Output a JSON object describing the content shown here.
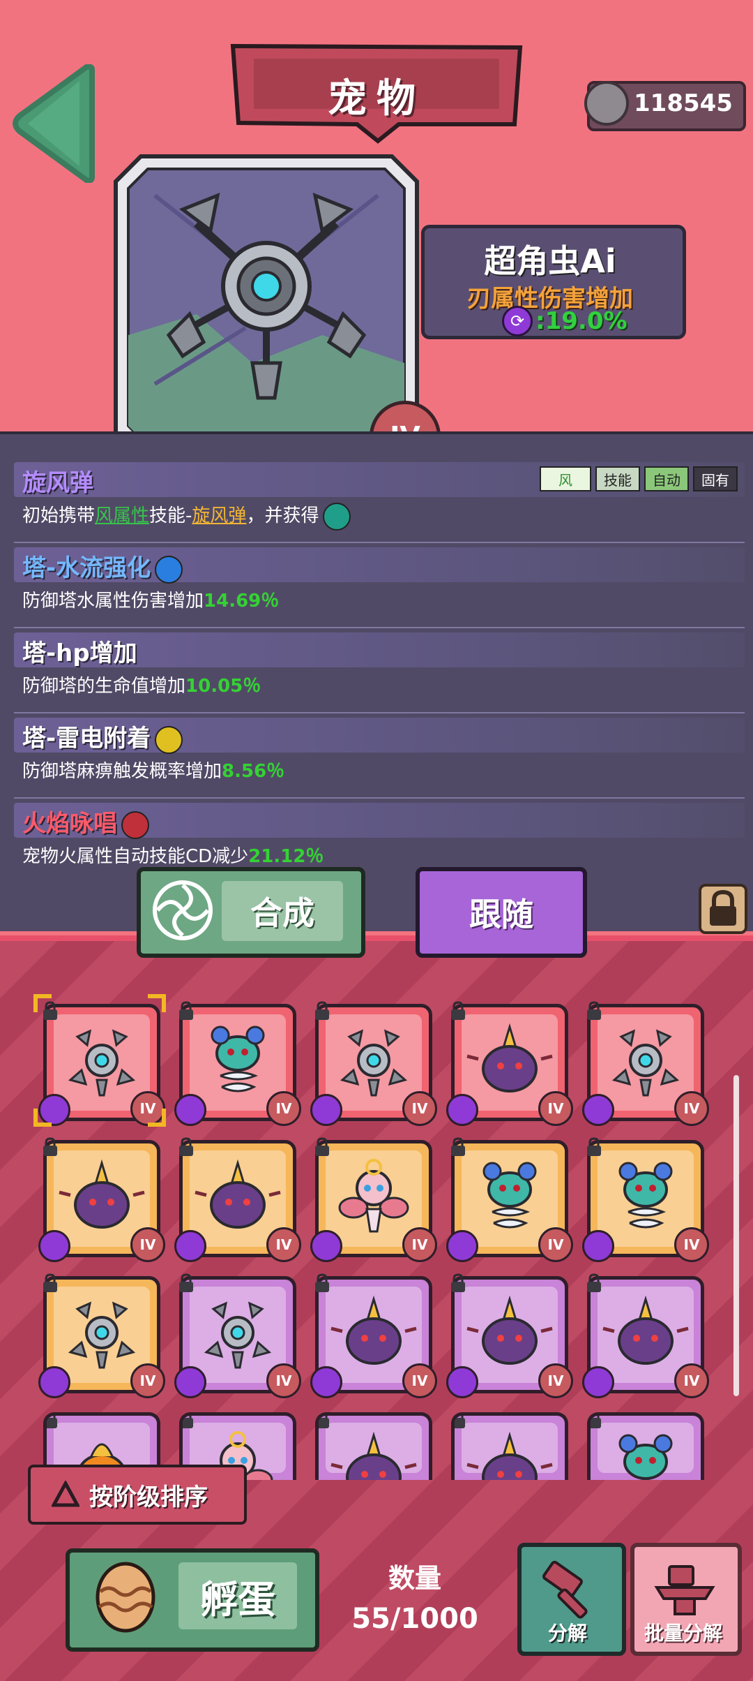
{
  "header": {
    "title": "宠物",
    "coins": "118545"
  },
  "pet": {
    "name": "超角虫Ai",
    "attribute": "刃属性伤害增加",
    "attribute_value": ":19.0%",
    "grade": "IV"
  },
  "skills": [
    {
      "title": "旋风弹",
      "tags": [
        "风",
        "技能",
        "自动",
        "固有"
      ],
      "desc_prefix": "初始携带",
      "desc_link1": "风属性",
      "desc_mid": "技能-",
      "desc_link2": "旋风弹",
      "desc_suffix": "，并获得"
    },
    {
      "title": "塔-水流强化",
      "desc": "防御塔水属性伤害增加",
      "value": "14.69％"
    },
    {
      "title": "塔-hp增加",
      "desc": "防御塔的生命值增加",
      "value": "10.05％"
    },
    {
      "title": "塔-雷电附着",
      "desc": "防御塔麻痹触发概率增加",
      "value": "8.56％"
    },
    {
      "title": "火焰咏唱",
      "desc": "宠物火属性自动技能CD减少",
      "value": "21.12％"
    }
  ],
  "buttons": {
    "merge": "合成",
    "follow": "跟随",
    "sort": "按阶级排序",
    "hatch": "孵蛋",
    "decompose": "分解",
    "batch_decompose": "批量分解"
  },
  "inventory": {
    "count_label": "数量",
    "count": "55/1000",
    "grid": [
      {
        "bg": "red",
        "pet": "robot",
        "grade": "IV"
      },
      {
        "bg": "red",
        "pet": "spring",
        "grade": "IV"
      },
      {
        "bg": "red",
        "pet": "robot",
        "grade": "IV"
      },
      {
        "bg": "red",
        "pet": "blob",
        "grade": "IV"
      },
      {
        "bg": "red",
        "pet": "robot",
        "grade": "IV"
      },
      {
        "bg": "orange",
        "pet": "blob",
        "grade": "IV"
      },
      {
        "bg": "orange",
        "pet": "blob",
        "grade": "IV"
      },
      {
        "bg": "orange",
        "pet": "fairy",
        "grade": "IV"
      },
      {
        "bg": "orange",
        "pet": "spring",
        "grade": "IV"
      },
      {
        "bg": "orange",
        "pet": "spring",
        "grade": "IV"
      },
      {
        "bg": "orange",
        "pet": "robot",
        "grade": "IV"
      },
      {
        "bg": "purple",
        "pet": "robot",
        "grade": "IV"
      },
      {
        "bg": "purple",
        "pet": "blob",
        "grade": "IV"
      },
      {
        "bg": "purple",
        "pet": "blob",
        "grade": "IV"
      },
      {
        "bg": "purple",
        "pet": "blob",
        "grade": "IV"
      },
      {
        "bg": "purple",
        "pet": "pumpkin",
        "grade": ""
      },
      {
        "bg": "purple",
        "pet": "fairy",
        "grade": ""
      },
      {
        "bg": "purple",
        "pet": "blob",
        "grade": ""
      },
      {
        "bg": "purple",
        "pet": "blob",
        "grade": ""
      },
      {
        "bg": "purple",
        "pet": "spring",
        "grade": ""
      }
    ]
  },
  "colors": {
    "background": "#f3737f",
    "panel": "#514a66",
    "green_value": "#34d234",
    "accent_orange": "#f4a23a"
  }
}
